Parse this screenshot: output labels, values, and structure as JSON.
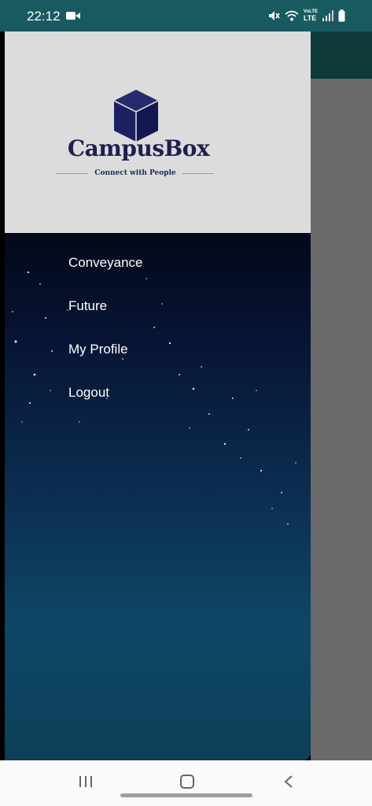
{
  "status_bar": {
    "time": "22:12",
    "icons": [
      "video-icon",
      "mute-icon",
      "wifi-icon",
      "lte-icon",
      "signal-icon",
      "battery-icon"
    ],
    "lte_top": "VoLTE",
    "lte_bottom": "LTE"
  },
  "drawer": {
    "logo": {
      "name": "CampusBox",
      "tagline": "Connect with People",
      "icon": "cube-icon",
      "brand_color": "#1f1f5c"
    },
    "menu": [
      {
        "label": "Conveyance"
      },
      {
        "label": "Future"
      },
      {
        "label": "My Profile"
      },
      {
        "label": "Logout"
      }
    ]
  },
  "nav_bar": {
    "icons": [
      "recent-apps-icon",
      "home-icon",
      "back-icon"
    ]
  }
}
